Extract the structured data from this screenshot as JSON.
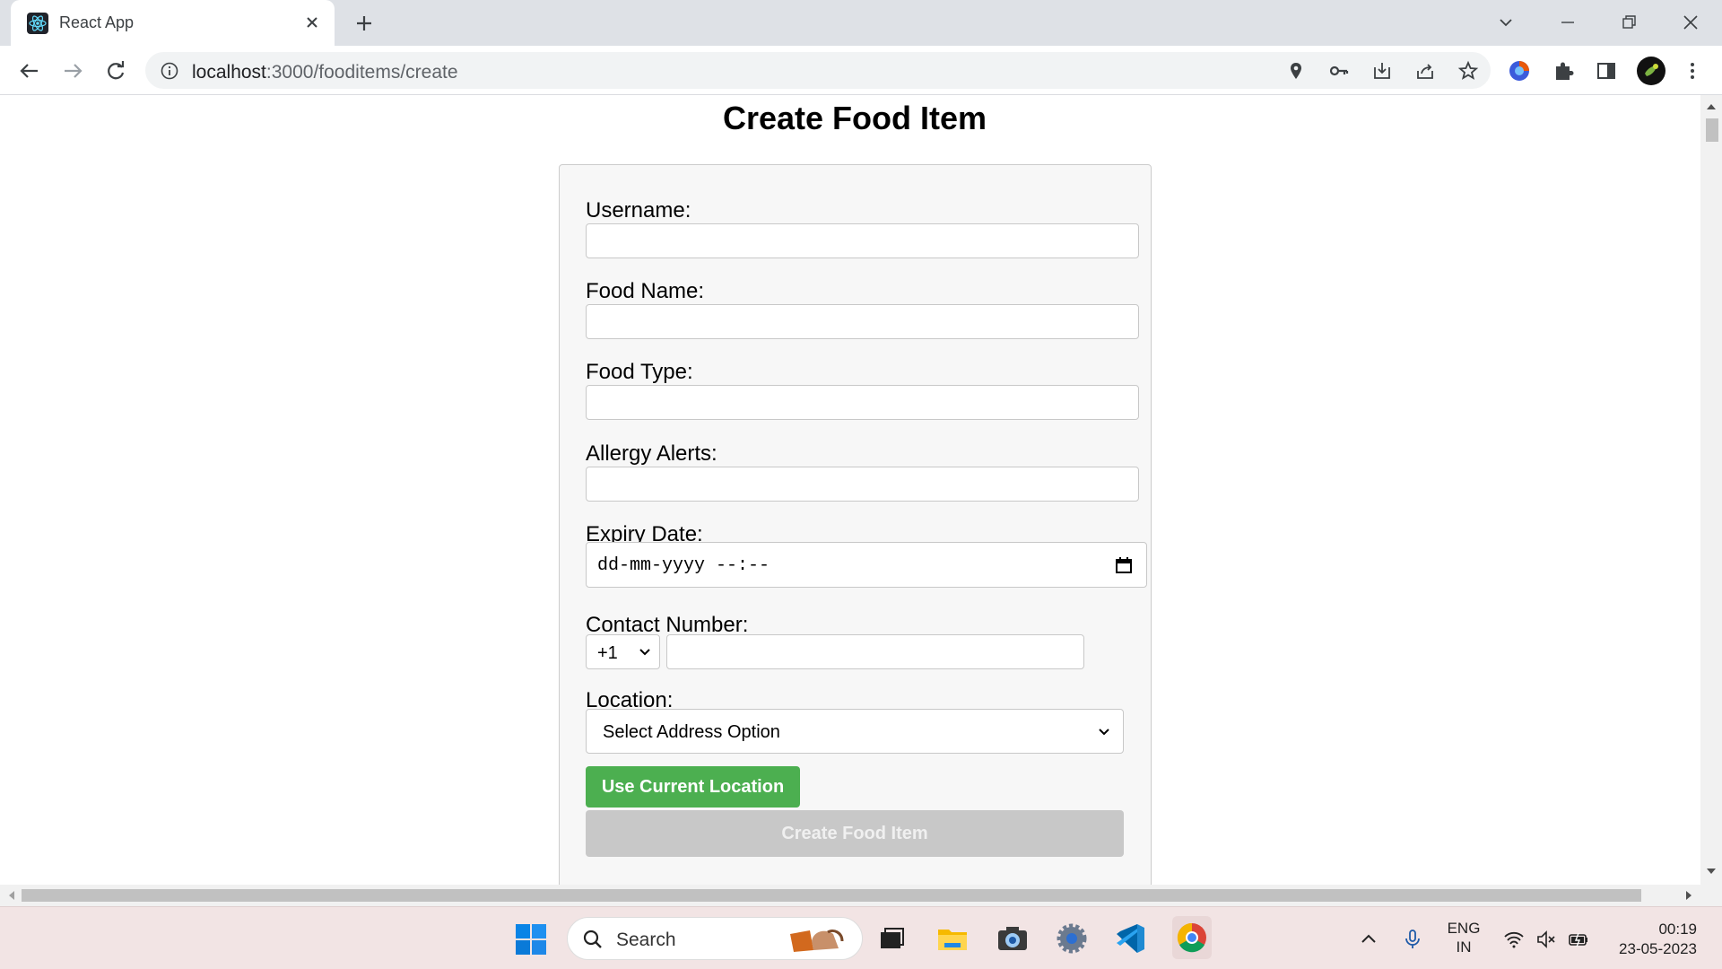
{
  "browser": {
    "tab_title": "React App",
    "url_host": "localhost",
    "url_path": ":3000/fooditems/create"
  },
  "page": {
    "title": "Create Food Item",
    "fields": {
      "username_label": "Username:",
      "food_name_label": "Food Name:",
      "food_type_label": "Food Type:",
      "allergy_label": "Allergy Alerts:",
      "expiry_label": "Expiry Date:",
      "expiry_placeholder": "dd-mm-yyyy --:--",
      "contact_label": "Contact Number:",
      "country_code": "+1",
      "location_label": "Location:",
      "location_selected": "Select Address Option"
    },
    "buttons": {
      "use_location": "Use Current Location",
      "create": "Create Food Item"
    }
  },
  "taskbar": {
    "search_text": "Search",
    "lang_line1": "ENG",
    "lang_line2": "IN",
    "time": "00:19",
    "date": "23-05-2023"
  },
  "colors": {
    "accent_green": "#4caf50",
    "disabled_gray": "#c8c8c8"
  }
}
